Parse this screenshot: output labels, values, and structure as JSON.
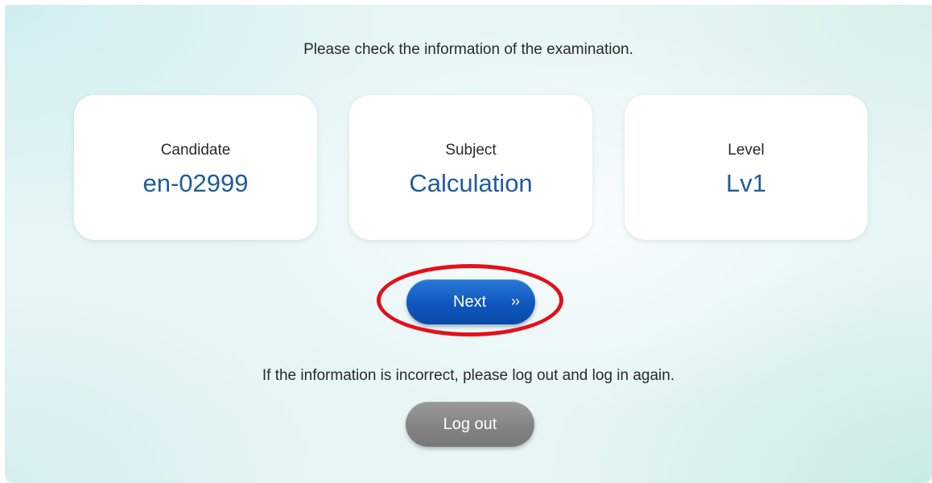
{
  "header": {
    "instruction": "Please check the information of the examination."
  },
  "cards": [
    {
      "label": "Candidate",
      "value": "en-02999"
    },
    {
      "label": "Subject",
      "value": "Calculation"
    },
    {
      "label": "Level",
      "value": "Lv1"
    }
  ],
  "next_button": {
    "label": "Next",
    "icon": "double-chevron-right-icon",
    "icon_glyph": "››"
  },
  "footer": {
    "info": "If the information is incorrect, please log out and log in again.",
    "logout_label": "Log out"
  },
  "colors": {
    "value_text": "#1f5c9b",
    "next_button": "#0f56bd",
    "logout_button": "#828282",
    "highlight_ring": "#e4101a"
  }
}
